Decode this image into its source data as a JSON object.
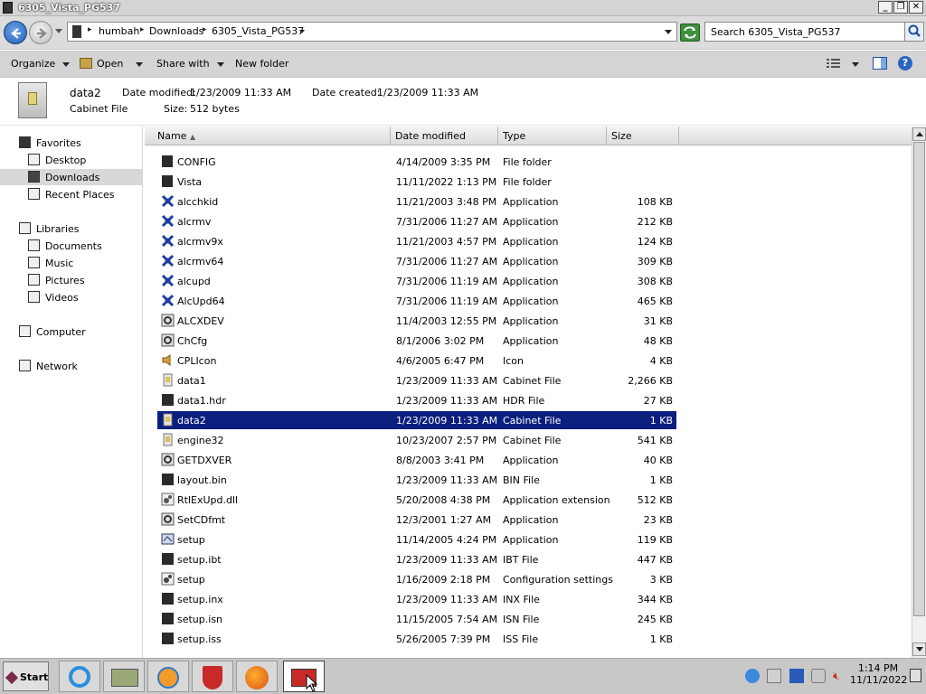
{
  "window": {
    "title": "6305_Vista_PG537",
    "minimize": "_",
    "restore": "❐",
    "close": "✕"
  },
  "address": {
    "crumbs": [
      "humbah",
      "Downloads",
      "6305_Vista_PG537"
    ],
    "separator": "▸"
  },
  "search": {
    "placeholder": "Search 6305_Vista_PG537"
  },
  "toolbar": {
    "organize": "Organize",
    "open": "Open",
    "share_with": "Share with",
    "new_folder": "New folder"
  },
  "details": {
    "name": "data2",
    "type": "Cabinet File",
    "date_modified_label": "Date modified:",
    "date_modified": "1/23/2009 11:33 AM",
    "date_created_label": "Date created:",
    "date_created": "1/23/2009 11:33 AM",
    "size_label": "Size:",
    "size": "512 bytes"
  },
  "nav": {
    "favorites": "Favorites",
    "desktop": "Desktop",
    "downloads": "Downloads",
    "recent_places": "Recent Places",
    "libraries": "Libraries",
    "documents": "Documents",
    "music": "Music",
    "pictures": "Pictures",
    "videos": "Videos",
    "computer": "Computer",
    "network": "Network"
  },
  "columns": {
    "name": "Name",
    "date_modified": "Date modified",
    "type": "Type",
    "size": "Size"
  },
  "files": [
    {
      "name": "CONFIG",
      "date": "4/14/2009 3:35 PM",
      "type": "File folder",
      "size": "",
      "icon": "folder-icon"
    },
    {
      "name": "Vista",
      "date": "11/11/2022 1:13 PM",
      "type": "File folder",
      "size": "",
      "icon": "folder-icon"
    },
    {
      "name": "alcchkid",
      "date": "11/21/2003 3:48 PM",
      "type": "Application",
      "size": "108 KB",
      "icon": "app-icon"
    },
    {
      "name": "alcrmv",
      "date": "7/31/2006 11:27 AM",
      "type": "Application",
      "size": "212 KB",
      "icon": "app-icon"
    },
    {
      "name": "alcrmv9x",
      "date": "11/21/2003 4:57 PM",
      "type": "Application",
      "size": "124 KB",
      "icon": "app-icon"
    },
    {
      "name": "alcrmv64",
      "date": "7/31/2006 11:27 AM",
      "type": "Application",
      "size": "309 KB",
      "icon": "app-icon"
    },
    {
      "name": "alcupd",
      "date": "7/31/2006 11:19 AM",
      "type": "Application",
      "size": "308 KB",
      "icon": "app-icon"
    },
    {
      "name": "AlcUpd64",
      "date": "7/31/2006 11:19 AM",
      "type": "Application",
      "size": "465 KB",
      "icon": "app-icon"
    },
    {
      "name": "ALCXDEV",
      "date": "11/4/2003 12:55 PM",
      "type": "Application",
      "size": "31 KB",
      "icon": "gear-app-icon"
    },
    {
      "name": "ChCfg",
      "date": "8/1/2006 3:02 PM",
      "type": "Application",
      "size": "48 KB",
      "icon": "gear-app-icon"
    },
    {
      "name": "CPLIcon",
      "date": "4/6/2005 6:47 PM",
      "type": "Icon",
      "size": "4 KB",
      "icon": "speaker-icon"
    },
    {
      "name": "data1",
      "date": "1/23/2009 11:33 AM",
      "type": "Cabinet File",
      "size": "2,266 KB",
      "icon": "cabinet-icon"
    },
    {
      "name": "data1.hdr",
      "date": "1/23/2009 11:33 AM",
      "type": "HDR File",
      "size": "27 KB",
      "icon": "file-icon"
    },
    {
      "name": "data2",
      "date": "1/23/2009 11:33 AM",
      "type": "Cabinet File",
      "size": "1 KB",
      "icon": "cabinet-icon"
    },
    {
      "name": "engine32",
      "date": "10/23/2007 2:57 PM",
      "type": "Cabinet File",
      "size": "541 KB",
      "icon": "cabinet-icon"
    },
    {
      "name": "GETDXVER",
      "date": "8/8/2003 3:41 PM",
      "type": "Application",
      "size": "40 KB",
      "icon": "gear-app-icon"
    },
    {
      "name": "layout.bin",
      "date": "1/23/2009 11:33 AM",
      "type": "BIN File",
      "size": "1 KB",
      "icon": "file-icon"
    },
    {
      "name": "RtlExUpd.dll",
      "date": "5/20/2008 4:38 PM",
      "type": "Application extension",
      "size": "512 KB",
      "icon": "dll-icon"
    },
    {
      "name": "SetCDfmt",
      "date": "12/3/2001 1:27 AM",
      "type": "Application",
      "size": "23 KB",
      "icon": "gear-app-icon"
    },
    {
      "name": "setup",
      "date": "11/14/2005 4:24 PM",
      "type": "Application",
      "size": "119 KB",
      "icon": "setup-icon"
    },
    {
      "name": "setup.ibt",
      "date": "1/23/2009 11:33 AM",
      "type": "IBT File",
      "size": "447 KB",
      "icon": "file-icon"
    },
    {
      "name": "setup",
      "date": "1/16/2009 2:18 PM",
      "type": "Configuration settings",
      "size": "3 KB",
      "icon": "config-icon"
    },
    {
      "name": "setup.inx",
      "date": "1/23/2009 11:33 AM",
      "type": "INX File",
      "size": "344 KB",
      "icon": "file-icon"
    },
    {
      "name": "setup.isn",
      "date": "11/15/2005 7:54 AM",
      "type": "ISN File",
      "size": "245 KB",
      "icon": "file-icon"
    },
    {
      "name": "setup.iss",
      "date": "5/26/2005 7:39 PM",
      "type": "ISS File",
      "size": "1 KB",
      "icon": "file-icon"
    }
  ],
  "selected_index": 13,
  "taskbar": {
    "start": "Start",
    "time": "1:14 PM",
    "date": "11/11/2022"
  },
  "colors": {
    "selection": "#0b1f7e",
    "app_icon": "#1f3fa0"
  }
}
